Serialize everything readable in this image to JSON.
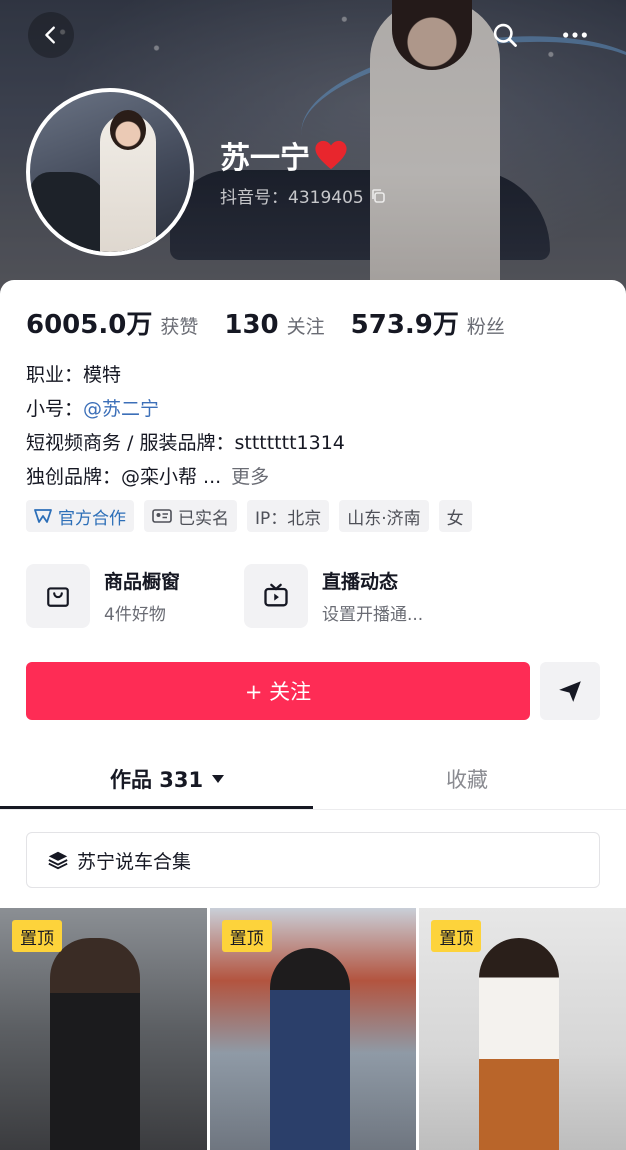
{
  "profile": {
    "name": "苏一宁",
    "douyin_id": "抖音号：4319405"
  },
  "stats": [
    {
      "value": "6005.0万",
      "label": "获赞"
    },
    {
      "value": "130",
      "label": "关注"
    },
    {
      "value": "573.9万",
      "label": "粉丝"
    }
  ],
  "info": {
    "occupation": "职业：模特",
    "alt_account_label": "小号：",
    "alt_account_link": "@苏二宁",
    "business": "短视频商务 / 服装品牌：sttttttt1314",
    "brand": "独创品牌：@栾小帮 ...",
    "more": "更多"
  },
  "tags": [
    {
      "label": "官方合作",
      "icon": "official-icon"
    },
    {
      "label": "已实名",
      "icon": "id-card-icon"
    },
    {
      "label": "IP：北京"
    },
    {
      "label": "山东·济南"
    },
    {
      "label": "女"
    }
  ],
  "services": [
    {
      "title": "商品橱窗",
      "sub": "4件好物",
      "icon": "shopping-bag-icon"
    },
    {
      "title": "直播动态",
      "sub": "设置开播通...",
      "icon": "tv-icon"
    }
  ],
  "follow_button": "+ 关注",
  "tabs": {
    "works": "作品 331",
    "collect": "收藏"
  },
  "collection": "苏宁说车合集",
  "thumbnails": [
    {
      "badge": "置顶"
    },
    {
      "badge": "置顶"
    },
    {
      "badge": "置顶"
    }
  ],
  "colors": {
    "accent": "#fe2c55",
    "link": "#3c6fb8",
    "pin_badge": "#fdd33b"
  }
}
